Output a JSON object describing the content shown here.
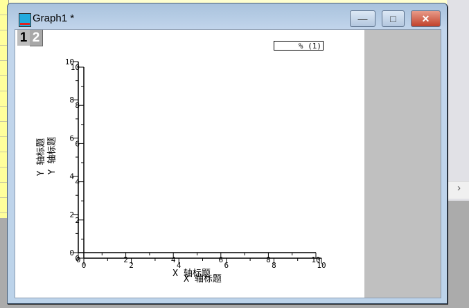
{
  "window": {
    "title": "Graph1 *",
    "minimize": "—",
    "maximize": "□",
    "close": "✕"
  },
  "layers": [
    {
      "label": "1",
      "active": true
    },
    {
      "label": "2",
      "active": false
    }
  ],
  "legend": {
    "text": "% (1)"
  },
  "background": {
    "scroll_right_icon": "›"
  },
  "chart_data": {
    "type": "line",
    "title": "",
    "layers": [
      {
        "name": "1",
        "xlabel": "X 轴标题",
        "ylabel": "Y 轴标题",
        "xlim": [
          0,
          10
        ],
        "ylim": [
          0,
          10
        ],
        "xticks": [
          "0",
          "2",
          "4",
          "6",
          "8",
          "10"
        ],
        "yticks": [
          "0",
          "2",
          "4",
          "6",
          "8",
          "10"
        ]
      },
      {
        "name": "2",
        "xlabel": "X 轴标题",
        "ylabel": "Y 轴标题",
        "xlim": [
          0,
          10
        ],
        "ylim": [
          0,
          10
        ],
        "xticks": [
          "0",
          "2",
          "4",
          "6",
          "8",
          "10"
        ],
        "yticks": [
          "0",
          "2",
          "4",
          "6",
          "8",
          "10"
        ]
      }
    ],
    "series": [],
    "grid": false
  }
}
